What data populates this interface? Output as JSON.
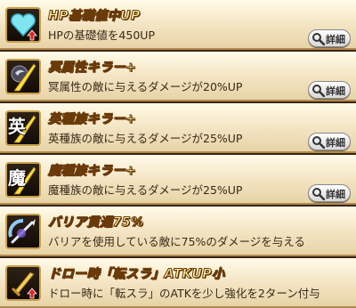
{
  "detail_label": "詳細",
  "abilities": [
    {
      "title": "HP基礎値中UP",
      "desc": "HPの基礎値を450UP",
      "icon": "heart-up-icon"
    },
    {
      "title": "冥属性キラー+",
      "desc": "冥属性の敵に与えるダメージが20%UP",
      "icon": "dark-element-slash-icon"
    },
    {
      "title": "英種族キラー+",
      "desc": "英種族の敵に与えるダメージが25%UP",
      "icon": "hero-race-slash-icon",
      "kanji": "英"
    },
    {
      "title": "魔種族キラー+",
      "desc": "魔種族の敵に与えるダメージが25%UP",
      "icon": "demon-race-slash-icon",
      "kanji": "魔"
    },
    {
      "title": "バリア貫通75%",
      "desc": "バリアを使用している敵に75%のダメージを与える",
      "icon": "barrier-pierce-icon"
    },
    {
      "title": "ドロー時「転スラ」ATKUP小",
      "desc": "ドロー時に「転スラ」のATKを少し強化を2ターン付与",
      "icon": "sword-up-icon"
    }
  ]
}
